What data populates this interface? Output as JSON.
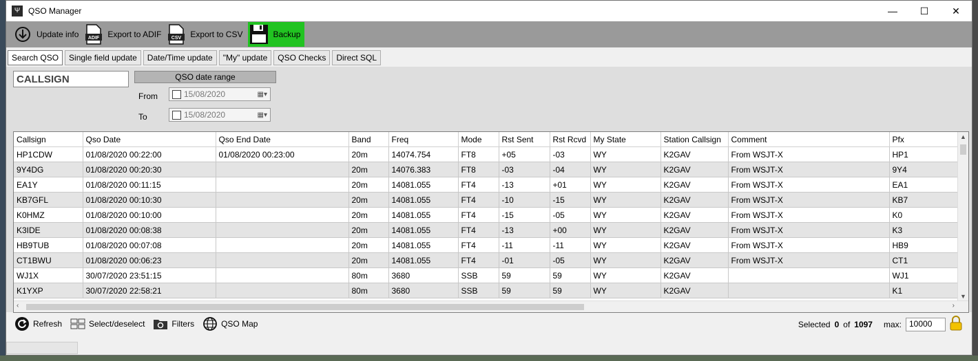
{
  "window": {
    "title": "QSO Manager"
  },
  "window_controls": {
    "minimize": "—",
    "maximize": "☐",
    "close": "✕"
  },
  "toolbar": [
    {
      "label": "Update info",
      "icon": "download-icon"
    },
    {
      "label": "Export to ADIF",
      "icon": "adif-file-icon",
      "icon_text": "ADIF"
    },
    {
      "label": "Export to CSV",
      "icon": "csv-file-icon",
      "icon_text": "CSV"
    },
    {
      "label": "Backup",
      "icon": "floppy-disk-icon",
      "highlight": "#21c321"
    }
  ],
  "tabs": [
    "Search QSO",
    "Single field update",
    "Date/Time update",
    "\"My\" update",
    "QSO Checks",
    "Direct SQL"
  ],
  "search": {
    "callsign_placeholder": "CALLSIGN",
    "date_range_title": "QSO date range",
    "from_label": "From",
    "from_value": "15/08/2020",
    "to_label": "To",
    "to_value": "15/08/2020"
  },
  "grid": {
    "columns": [
      "Callsign",
      "Qso Date",
      "Qso End Date",
      "Band",
      "Freq",
      "Mode",
      "Rst Sent",
      "Rst Rcvd",
      "My State",
      "Station Callsign",
      "Comment",
      "Pfx"
    ],
    "rows": [
      [
        "HP1CDW",
        "01/08/2020 00:22:00",
        "01/08/2020 00:23:00",
        "20m",
        "14074.754",
        "FT8",
        "+05",
        "-03",
        "WY",
        "K2GAV",
        "From WSJT-X",
        "HP1"
      ],
      [
        "9Y4DG",
        "01/08/2020 00:20:30",
        "",
        "20m",
        "14076.383",
        "FT8",
        "-03",
        "-04",
        "WY",
        "K2GAV",
        "From WSJT-X",
        "9Y4"
      ],
      [
        "EA1Y",
        "01/08/2020 00:11:15",
        "",
        "20m",
        "14081.055",
        "FT4",
        "-13",
        "+01",
        "WY",
        "K2GAV",
        "From WSJT-X",
        "EA1"
      ],
      [
        "KB7GFL",
        "01/08/2020 00:10:30",
        "",
        "20m",
        "14081.055",
        "FT4",
        "-10",
        "-15",
        "WY",
        "K2GAV",
        "From WSJT-X",
        "KB7"
      ],
      [
        "K0HMZ",
        "01/08/2020 00:10:00",
        "",
        "20m",
        "14081.055",
        "FT4",
        "-15",
        "-05",
        "WY",
        "K2GAV",
        "From WSJT-X",
        "K0"
      ],
      [
        "K3IDE",
        "01/08/2020 00:08:38",
        "",
        "20m",
        "14081.055",
        "FT4",
        "-13",
        "+00",
        "WY",
        "K2GAV",
        "From WSJT-X",
        "K3"
      ],
      [
        "HB9TUB",
        "01/08/2020 00:07:08",
        "",
        "20m",
        "14081.055",
        "FT4",
        "-11",
        "-11",
        "WY",
        "K2GAV",
        "From WSJT-X",
        "HB9"
      ],
      [
        "CT1BWU",
        "01/08/2020 00:06:23",
        "",
        "20m",
        "14081.055",
        "FT4",
        "-01",
        "-05",
        "WY",
        "K2GAV",
        "From WSJT-X",
        "CT1"
      ],
      [
        "WJ1X",
        "30/07/2020 23:51:15",
        "",
        "80m",
        "3680",
        "SSB",
        "59",
        "59",
        "WY",
        "K2GAV",
        "",
        "WJ1"
      ],
      [
        "K1YXP",
        "30/07/2020 22:58:21",
        "",
        "80m",
        "3680",
        "SSB",
        "59",
        "59",
        "WY",
        "K2GAV",
        "",
        "K1"
      ]
    ]
  },
  "bottom": {
    "buttons": [
      {
        "label": "Refresh",
        "icon": "refresh-icon"
      },
      {
        "label": "Select/deselect",
        "icon": "select-grid-icon"
      },
      {
        "label": "Filters",
        "icon": "folder-filter-icon"
      },
      {
        "label": "QSO Map",
        "icon": "globe-icon"
      }
    ],
    "selected_label": "Selected",
    "selected_count": "0",
    "of_label": "of",
    "total_count": "1097",
    "max_label": "max:",
    "max_value": "10000"
  }
}
